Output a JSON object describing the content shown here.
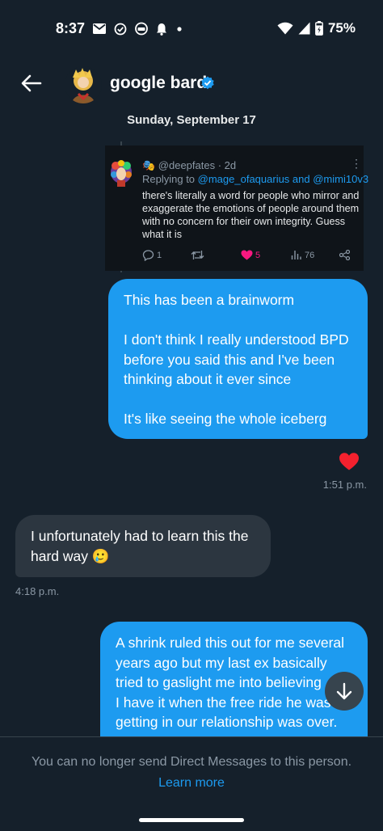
{
  "status_bar": {
    "time": "8:37",
    "battery_percent": "75%",
    "icons_left": [
      "mail-icon",
      "check-circle-icon",
      "headset-icon",
      "bell-icon",
      "dot-icon"
    ],
    "icons_right": [
      "wifi-icon",
      "signal-icon",
      "battery-charging-icon"
    ]
  },
  "header": {
    "name": "google bard",
    "verified": true,
    "accent_color": "#1d9bf0"
  },
  "date_label": "Sunday, September 17",
  "quoted_tweet": {
    "author": "🎭 @deepfates · 2d",
    "replying_prefix": "Replying to ",
    "replying_mentions": "@mage_ofaquarius and @mimi10v3",
    "text": "there's literally a word for people who mirror and exaggerate the emotions of people around them with no concern for their own integrity. Guess what it is",
    "replies": "1",
    "likes": "5",
    "views": "76"
  },
  "messages": [
    {
      "direction": "sent",
      "lines": [
        "This has been a brainworm",
        "",
        "I don't think I really understood BPD",
        "before you said this and I've been",
        "thinking about it ever since",
        "",
        "It's like seeing the whole iceberg"
      ],
      "reaction": "heart-icon",
      "time": "1:51 p.m."
    },
    {
      "direction": "received",
      "lines": [
        "I unfortunately had to learn this the",
        "hard way 🥲"
      ],
      "time": "4:18 p.m."
    },
    {
      "direction": "sent",
      "lines": [
        "A shrink ruled this out for me several",
        "years ago but my last ex basically",
        "tried to gaslight me into believing",
        "I have it when the free ride he was",
        "getting in our relationship was over."
      ]
    }
  ],
  "footer": {
    "notice": "You can no longer send Direct Messages to this person.",
    "link": "Learn more"
  }
}
